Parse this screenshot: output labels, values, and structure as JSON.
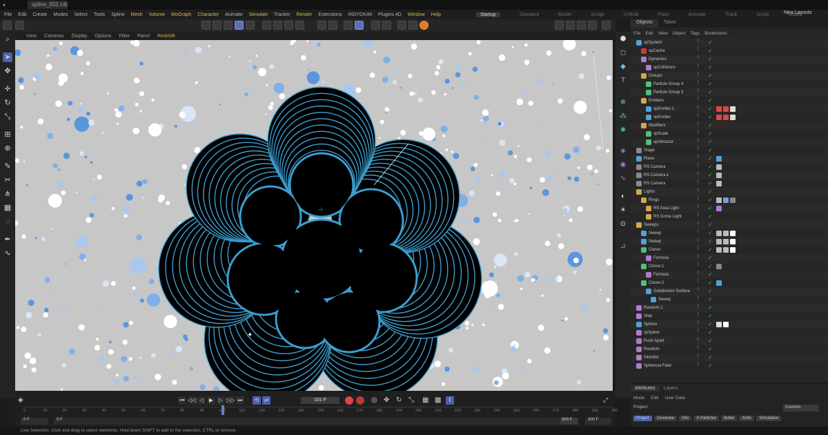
{
  "window": {
    "doc_tab": "spline_002.c4d *"
  },
  "menu": {
    "items": [
      "File",
      "Edit",
      "Create",
      "Modes",
      "Select",
      "Tools",
      "Spline",
      "Mesh",
      "Volume",
      "MoGraph",
      "Character",
      "Animate",
      "Simulate",
      "Tracker",
      "Render",
      "Extensions",
      "INSYDIUM",
      "Plugins 4D",
      "Window",
      "Help"
    ],
    "highlighted": [
      "Mesh",
      "Volume",
      "MoGraph",
      "Character",
      "Simulate",
      "Render",
      "Window",
      "Help"
    ]
  },
  "layouts": {
    "items": [
      "Startup",
      "Standard",
      "Model",
      "Sculpt",
      "UVEdit",
      "Paint",
      "Animate",
      "Track",
      "Script",
      "Nodes"
    ],
    "active": "Startup",
    "new_layouts": "New Layouts"
  },
  "viewport_menu": {
    "items": [
      "View",
      "Cameras",
      "Display",
      "Options",
      "Filter",
      "Panel",
      "Redshift"
    ],
    "active": "Redshift"
  },
  "colors": {
    "accent": "#4d5fae",
    "viewport_bg": "#c7c7c7",
    "spline_line": "#3d9fd0",
    "check": "#2ecc40",
    "highlight_menu": "#e0b64d"
  },
  "object_panel": {
    "tabs": [
      "Objects",
      "Takes"
    ],
    "menu": [
      "File",
      "Edit",
      "View",
      "Object",
      "Tags",
      "Bookmarks"
    ],
    "rows": [
      {
        "name": "xpSystem",
        "indent": 0,
        "color": "#4fa3d8"
      },
      {
        "name": "xpCache",
        "indent": 1,
        "color": "#d03b3b"
      },
      {
        "name": "Dynamics",
        "indent": 1,
        "color": "#b07ad0"
      },
      {
        "name": "xpCollisions",
        "indent": 2,
        "color": "#b07ad0"
      },
      {
        "name": "Groups",
        "indent": 1,
        "color": "#d0a84d"
      },
      {
        "name": "Particle Group 4",
        "indent": 2,
        "color": "#4dc07a"
      },
      {
        "name": "Particle Group 3",
        "indent": 2,
        "color": "#4dc07a"
      },
      {
        "name": "Emitters",
        "indent": 1,
        "color": "#d0a84d"
      },
      {
        "name": "xpEmitter.1",
        "indent": 2,
        "color": "#4fa3d8"
      },
      {
        "name": "xpEmitter",
        "indent": 2,
        "color": "#4fa3d8"
      },
      {
        "name": "Modifiers",
        "indent": 1,
        "color": "#d0a84d"
      },
      {
        "name": "xpScale",
        "indent": 2,
        "color": "#4dc07a"
      },
      {
        "name": "xpAttractor",
        "indent": 2,
        "color": "#4dc07a"
      },
      {
        "name": "Stage",
        "indent": 0,
        "color": "#8a8a8a"
      },
      {
        "name": "Plane",
        "indent": 0,
        "color": "#4fa3d8"
      },
      {
        "name": "RS Camera",
        "indent": 0,
        "color": "#8a8a8a"
      },
      {
        "name": "RS Camera.1",
        "indent": 0,
        "color": "#8a8a8a"
      },
      {
        "name": "RS Camera",
        "indent": 0,
        "color": "#8a8a8a"
      },
      {
        "name": "Lights",
        "indent": 0,
        "color": "#d0a84d"
      },
      {
        "name": "Rings",
        "indent": 1,
        "color": "#d0a84d"
      },
      {
        "name": "RS Area Light",
        "indent": 2,
        "color": "#d0a84d"
      },
      {
        "name": "RS Dome Light",
        "indent": 2,
        "color": "#d0a84d"
      },
      {
        "name": "Sweeps",
        "indent": 0,
        "color": "#d0a84d"
      },
      {
        "name": "Sweep",
        "indent": 1,
        "color": "#4fa3d8"
      },
      {
        "name": "Sweep",
        "indent": 1,
        "color": "#4fa3d8"
      },
      {
        "name": "Cloner",
        "indent": 1,
        "color": "#4dc07a"
      },
      {
        "name": "Formula",
        "indent": 2,
        "color": "#b07ad0"
      },
      {
        "name": "Cloner.1",
        "indent": 1,
        "color": "#4dc07a"
      },
      {
        "name": "Formula",
        "indent": 2,
        "color": "#b07ad0"
      },
      {
        "name": "Cloner.2",
        "indent": 1,
        "color": "#4dc07a"
      },
      {
        "name": "Subdivision Surface",
        "indent": 2,
        "color": "#4fa3d8"
      },
      {
        "name": "Sweep",
        "indent": 3,
        "color": "#4fa3d8"
      },
      {
        "name": "Random.1",
        "indent": 0,
        "color": "#b07ad0"
      },
      {
        "name": "Step",
        "indent": 0,
        "color": "#b07ad0"
      },
      {
        "name": "Sphere",
        "indent": 0,
        "color": "#4fa3d8"
      },
      {
        "name": "xpSpline",
        "indent": 0,
        "color": "#b07ad0"
      },
      {
        "name": "Push Apart",
        "indent": 0,
        "color": "#b07ad0"
      },
      {
        "name": "Random",
        "indent": 0,
        "color": "#b07ad0"
      },
      {
        "name": "Inheritor",
        "indent": 0,
        "color": "#b07ad0"
      },
      {
        "name": "Spherical Field",
        "indent": 0,
        "color": "#b07ad0"
      }
    ]
  },
  "attributes": {
    "tabs": [
      "Attributes",
      "Layers"
    ],
    "menu": [
      "Mode",
      "Edit",
      "User Data"
    ],
    "selection": "Project",
    "dropdown": "Custom",
    "buttons": [
      "Project",
      "Cineware",
      "Info",
      "X-Particles",
      "Bullet",
      "Xrefs",
      "Simulation"
    ],
    "active_button": "Project"
  },
  "timeline": {
    "current_frame": "101 F",
    "ruler_labels": [
      "0",
      "10",
      "20",
      "30",
      "40",
      "50",
      "60",
      "70",
      "80",
      "90",
      "100",
      "110",
      "120",
      "130",
      "140",
      "150",
      "160",
      "170",
      "180",
      "190",
      "200",
      "210",
      "220",
      "230",
      "240",
      "250",
      "260",
      "270",
      "280",
      "290",
      "300"
    ],
    "start_field": "0 F",
    "start_field2": "0 F",
    "end_field": "300 F",
    "end_field2": "300 F",
    "playhead_fraction": 0.337
  },
  "status": {
    "text": "Live Selection: Click and drag to select elements. Hold down SHIFT to add to the selection, CTRL to remove."
  }
}
